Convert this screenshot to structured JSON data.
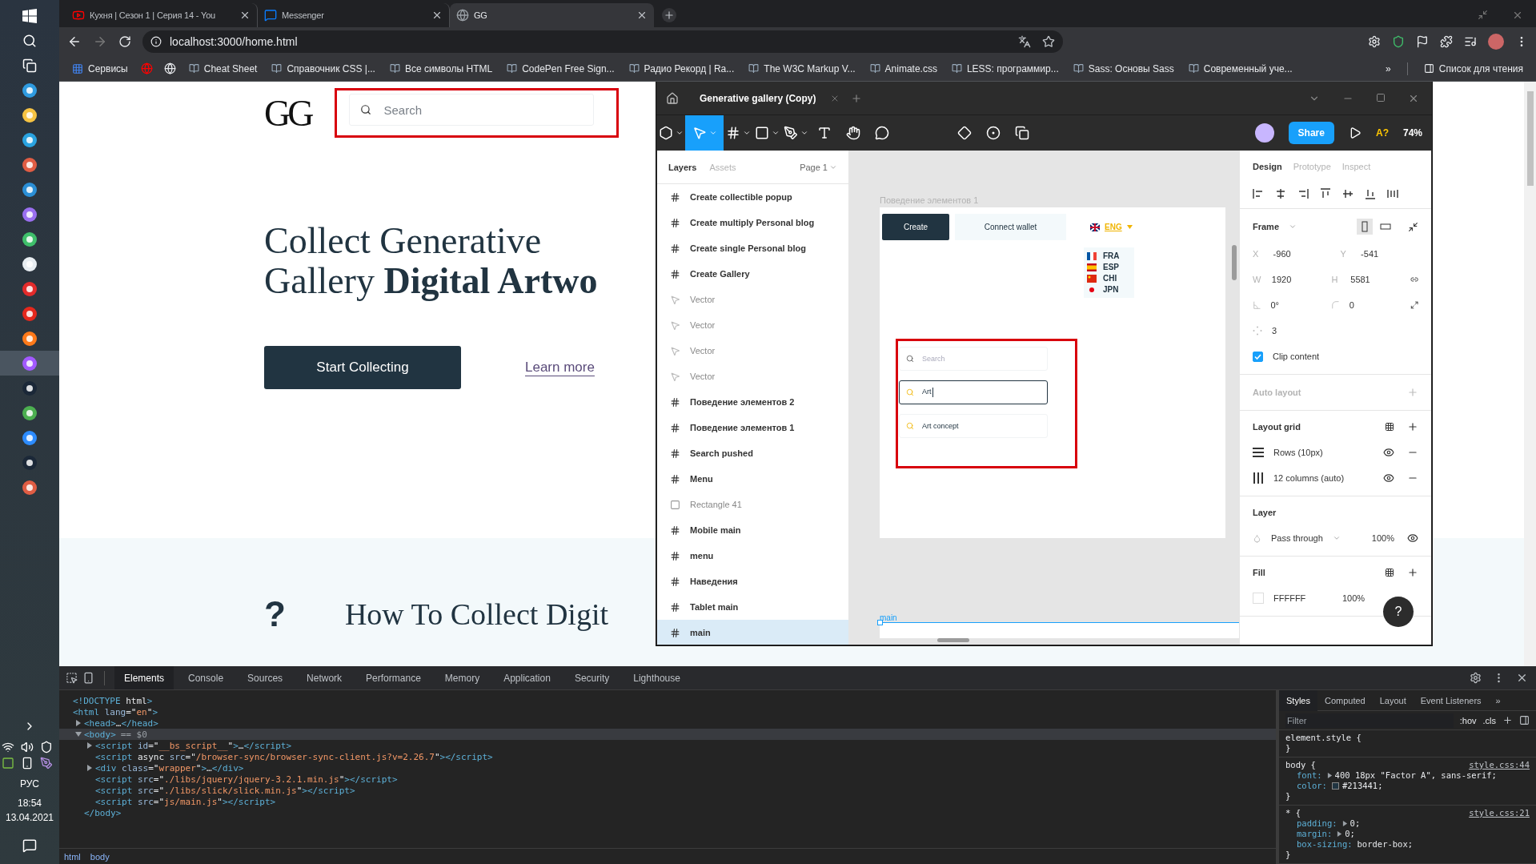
{
  "taskbar": {
    "apps": [
      {
        "selected": false
      },
      {
        "selected": false
      },
      {
        "selected": false
      },
      {
        "selected": false
      },
      {
        "selected": false
      },
      {
        "selected": false
      },
      {
        "selected": false
      },
      {
        "selected": false
      },
      {
        "selected": false
      },
      {
        "selected": false
      },
      {
        "selected": false
      },
      {
        "selected": true
      },
      {
        "selected": false
      },
      {
        "selected": false
      },
      {
        "selected": false
      },
      {
        "selected": false
      },
      {
        "selected": false
      }
    ],
    "tray": {
      "language": "РУС",
      "time": "18:54",
      "date": "13.04.2021"
    }
  },
  "browser": {
    "tabs": [
      {
        "title": "Кухня | Сезон 1 | Серия 14 - You",
        "kind": "video",
        "selected": false
      },
      {
        "title": "Messenger",
        "kind": "chat",
        "selected": false
      },
      {
        "title": "GG",
        "kind": "globe",
        "selected": true
      }
    ],
    "url": "localhost:3000/home.html",
    "bookmarks": [
      {
        "kind": "apps",
        "label": "Сервисы"
      },
      {
        "kind": "icon"
      },
      {
        "kind": "icon"
      },
      {
        "kind": "link",
        "label": "Cheat Sheet"
      },
      {
        "kind": "link",
        "label": "Справочник CSS |..."
      },
      {
        "kind": "link",
        "label": "Все символы HTML"
      },
      {
        "kind": "link",
        "label": "CodePen Free Sign..."
      },
      {
        "kind": "link",
        "label": "Радио Рекорд | Ra..."
      },
      {
        "kind": "link",
        "label": "The W3C Markup V..."
      },
      {
        "kind": "link",
        "label": "Animate.css"
      },
      {
        "kind": "link",
        "label": "LESS: программир..."
      },
      {
        "kind": "link",
        "label": "Sass: Основы Sass"
      },
      {
        "kind": "link",
        "label": "Современный уче..."
      }
    ],
    "more": "»",
    "reading_list": "Список для чтения"
  },
  "site": {
    "logo": "GG",
    "search_placeholder": "Search",
    "title_line1": "Collect Generative",
    "title_line2": "Gallery **Digital Artwo**",
    "primary_button": "Start Collecting",
    "link": "Learn more",
    "faq_mark": "?",
    "section_title": "How To Collect Digit"
  },
  "figma": {
    "file_tab": "Generative gallery (Copy)",
    "tools": [
      {
        "kind": "main-menu",
        "selected": false
      },
      {
        "kind": "move",
        "selected": true
      },
      {
        "kind": "frame",
        "selected": false
      },
      {
        "kind": "shape",
        "selected": false
      },
      {
        "kind": "pen",
        "selected": false
      },
      {
        "kind": "text",
        "selected": false
      },
      {
        "kind": "hand",
        "selected": false
      },
      {
        "kind": "comment",
        "selected": false
      }
    ],
    "share": "Share",
    "a11y": "A?",
    "zoom": "74%",
    "panel_tabs": [
      {
        "label": "Layers",
        "selected": true
      },
      {
        "label": "Assets",
        "selected": false
      }
    ],
    "page": "Page 1",
    "layers": [
      {
        "kind": "frame",
        "name": "Create collectible popup",
        "selected": false
      },
      {
        "kind": "frame",
        "name": "Create multiply Personal blog",
        "selected": false
      },
      {
        "kind": "frame",
        "name": "Create single Personal blog",
        "selected": false
      },
      {
        "kind": "frame",
        "name": "Create Gallery",
        "selected": false
      },
      {
        "kind": "vector",
        "name": "Vector",
        "selected": false
      },
      {
        "kind": "vector",
        "name": "Vector",
        "selected": false
      },
      {
        "kind": "vector",
        "name": "Vector",
        "selected": false
      },
      {
        "kind": "vector",
        "name": "Vector",
        "selected": false
      },
      {
        "kind": "frame",
        "name": "Поведение элементов 2",
        "selected": false
      },
      {
        "kind": "frame",
        "name": "Поведение элементов 1",
        "selected": false
      },
      {
        "kind": "frame",
        "name": "Search pushed",
        "selected": false
      },
      {
        "kind": "frame",
        "name": "Menu",
        "selected": false
      },
      {
        "kind": "rectangle",
        "name": "Rectangle 41",
        "selected": false
      },
      {
        "kind": "frame",
        "name": "Mobile main",
        "selected": false
      },
      {
        "kind": "frame",
        "name": "menu",
        "selected": false
      },
      {
        "kind": "frame",
        "name": "Наведения",
        "selected": false
      },
      {
        "kind": "frame",
        "name": "Tablet main",
        "selected": false
      },
      {
        "kind": "frame",
        "name": "main",
        "selected": true
      }
    ],
    "canvas": {
      "frame_label": "Поведение элементов 1",
      "create_button": "Create",
      "connect_button": "Connect wallet",
      "language": "ENG",
      "languages": [
        {
          "code": "FRA",
          "kind": "fr"
        },
        {
          "code": "ESP",
          "kind": "es"
        },
        {
          "code": "CHI",
          "kind": "cn"
        },
        {
          "code": "JPN",
          "kind": "jp"
        }
      ],
      "search_states": [
        {
          "kind": "empty",
          "text": "Search"
        },
        {
          "kind": "focused",
          "text": "Art"
        },
        {
          "kind": "result",
          "text": "Art concept"
        }
      ],
      "bottom_frame_label": "main"
    },
    "inspector": {
      "tabs": [
        {
          "label": "Design",
          "selected": true
        },
        {
          "label": "Prototype",
          "selected": false
        },
        {
          "label": "Inspect",
          "selected": false
        }
      ],
      "frame_title": "Frame",
      "orientation": [
        {
          "kind": "portrait",
          "selected": true
        },
        {
          "kind": "landscape",
          "selected": false
        }
      ],
      "position": [
        {
          "label": "X",
          "value": "-960"
        },
        {
          "label": "Y",
          "value": "-541"
        }
      ],
      "size": [
        {
          "label": "W",
          "value": "1920"
        },
        {
          "label": "H",
          "value": "5581"
        }
      ],
      "rotation": "0°",
      "radius": "0",
      "count": "3",
      "clip": {
        "label": "Clip content",
        "checked": true
      },
      "auto_layout": "Auto layout",
      "layout_grid": "Layout grid",
      "grids": [
        {
          "kind": "rows",
          "label": "Rows (10px)",
          "visible": true
        },
        {
          "kind": "columns",
          "label": "12 columns (auto)",
          "visible": true
        }
      ],
      "layer_title": "Layer",
      "blend": "Pass through",
      "opacity": "100%",
      "fill_title": "Fill",
      "fill_hex": "FFFFFF",
      "fill_opacity": "100%",
      "help": "?"
    }
  },
  "devtools": {
    "tabs": [
      {
        "label": "Elements",
        "selected": true
      },
      {
        "label": "Console",
        "selected": false
      },
      {
        "label": "Sources",
        "selected": false
      },
      {
        "label": "Network",
        "selected": false
      },
      {
        "label": "Performance",
        "selected": false
      },
      {
        "label": "Memory",
        "selected": false
      },
      {
        "label": "Application",
        "selected": false
      },
      {
        "label": "Security",
        "selected": false
      },
      {
        "label": "Lighthouse",
        "selected": false
      }
    ],
    "dom": [
      {
        "text": "<!DOCTYPE html>",
        "selected": false
      },
      {
        "text": "<html lang=\"en\">",
        "selected": false,
        "children": [
          {
            "text": "<head>…</head>",
            "expanded": false,
            "selected": false
          },
          {
            "text": "<body>",
            "note": "== $0",
            "expanded": true,
            "selected": true,
            "close": "</body>",
            "children": [
              {
                "text": "<script id=\"__bs_script__\">…</script>",
                "expanded": false,
                "selected": false
              },
              {
                "text": "<script async src=\"/browser-sync/browser-sync-client.js?v=2.26.7\"></script>",
                "selected": false
              },
              {
                "text": "<div class=\"wrapper\">…</div>",
                "expanded": false,
                "selected": false
              },
              {
                "text": "<script src=\"./libs/jquery/jquery-3.2.1.min.js\"></script>",
                "selected": false
              },
              {
                "text": "<script src=\"./libs/slick/slick.min.js\"></script>",
                "selected": false
              },
              {
                "text": "<script src=\"js/main.js\"></script>",
                "selected": false
              }
            ]
          }
        ]
      }
    ],
    "breadcrumbs": [
      "html",
      "body"
    ],
    "style_tabs": [
      {
        "label": "Styles",
        "selected": true
      },
      {
        "label": "Computed",
        "selected": false
      },
      {
        "label": "Layout",
        "selected": false
      },
      {
        "label": "Event Listeners",
        "selected": false
      }
    ],
    "style_more": "»",
    "filter_placeholder": "Filter",
    "hov": ":hov",
    "cls": ".cls",
    "rules": [
      {
        "selector": "element.style {",
        "close": "}"
      },
      {
        "selector": "body {",
        "source": "style.css:44",
        "close": "}",
        "props": [
          {
            "name": "font:",
            "value": "400 18px \"Factor A\", sans-serif;",
            "expandable": true
          },
          {
            "name": "color:",
            "value": "#213441;",
            "color": "#213441"
          }
        ]
      },
      {
        "selector": "* {",
        "source": "style.css:21",
        "close": "}",
        "props": [
          {
            "name": "padding:",
            "value": "0;",
            "expandable": true
          },
          {
            "name": "margin:",
            "value": "0;",
            "expandable": true
          },
          {
            "name": "box-sizing:",
            "value": "border-box;"
          }
        ]
      }
    ]
  }
}
